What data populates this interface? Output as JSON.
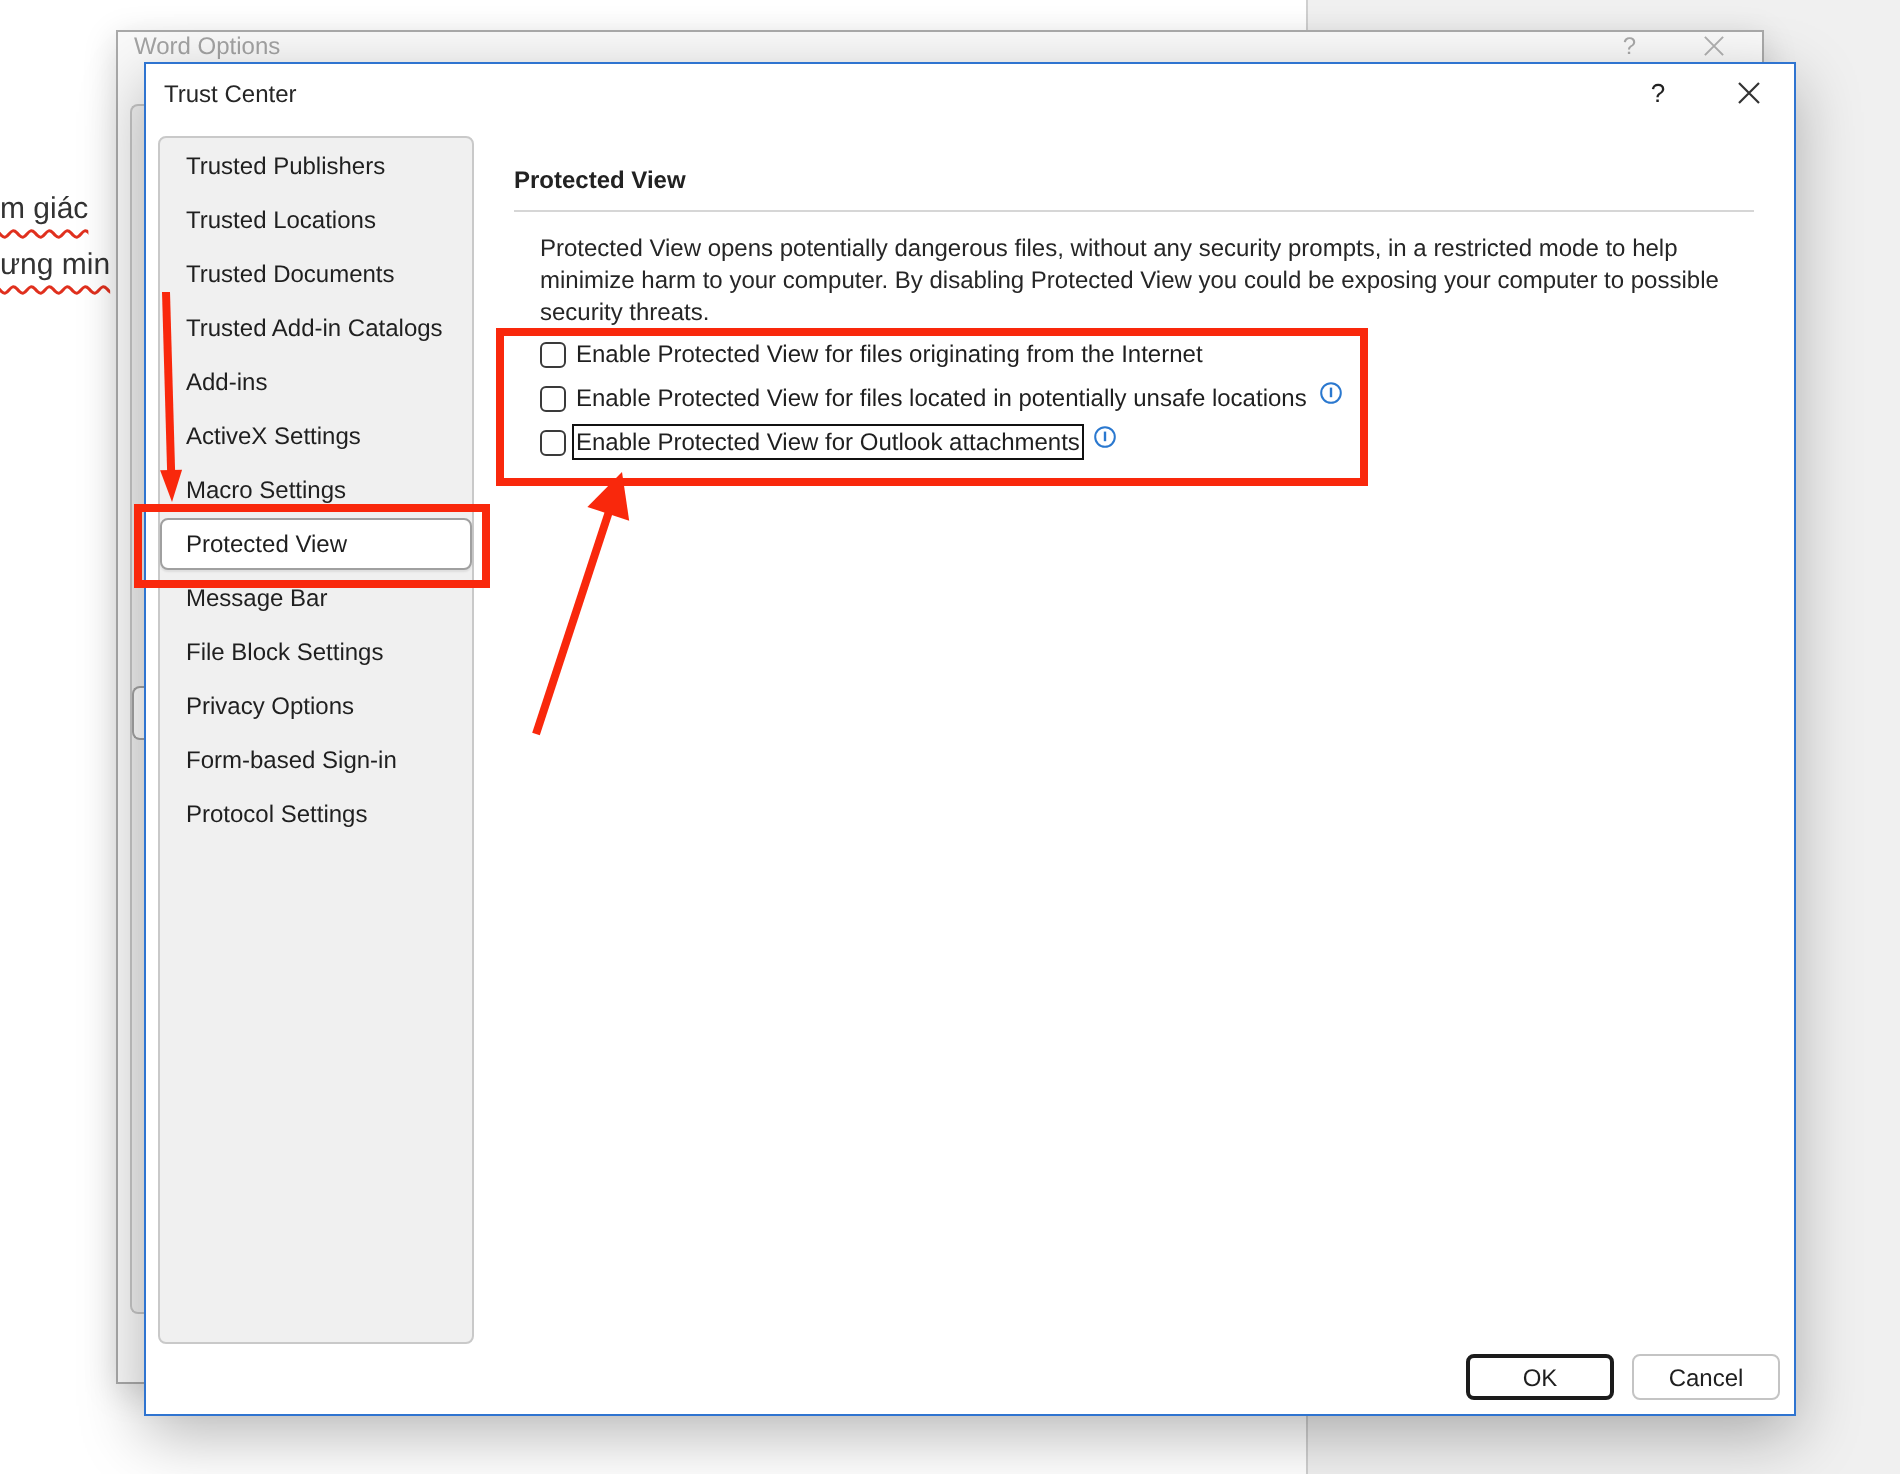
{
  "document": {
    "lines": [
      {
        "text": "m giác",
        "spelling_error": true
      },
      {
        "text": "ưng min",
        "spelling_error": true
      }
    ]
  },
  "background_window": {
    "title": "Word Options",
    "help_button": "?"
  },
  "window": {
    "title": "Trust Center",
    "help_button": "?"
  },
  "sidebar": {
    "items": [
      {
        "label": "Trusted Publishers",
        "selected": false,
        "annotated": false
      },
      {
        "label": "Trusted Locations",
        "selected": false,
        "annotated": false
      },
      {
        "label": "Trusted Documents",
        "selected": false,
        "annotated": false
      },
      {
        "label": "Trusted Add-in Catalogs",
        "selected": false,
        "annotated": false
      },
      {
        "label": "Add-ins",
        "selected": false,
        "annotated": false
      },
      {
        "label": "ActiveX Settings",
        "selected": false,
        "annotated": false
      },
      {
        "label": "Macro Settings",
        "selected": false,
        "annotated": false
      },
      {
        "label": "Protected View",
        "selected": true,
        "annotated": true
      },
      {
        "label": "Message Bar",
        "selected": false,
        "annotated": false
      },
      {
        "label": "File Block Settings",
        "selected": false,
        "annotated": false
      },
      {
        "label": "Privacy Options",
        "selected": false,
        "annotated": false
      },
      {
        "label": "Form-based Sign-in",
        "selected": false,
        "annotated": false
      },
      {
        "label": "Protocol Settings",
        "selected": false,
        "annotated": false
      }
    ]
  },
  "content": {
    "heading": "Protected View",
    "description": "Protected View opens potentially dangerous files, without any security prompts, in a restricted mode to help minimize harm to your computer. By disabling Protected View you could be exposing your computer to possible security threats.",
    "options_annotated": true,
    "options": [
      {
        "label": "Enable Protected View for files originating from the Internet",
        "checked": false,
        "focused": false,
        "info": false
      },
      {
        "label": "Enable Protected View for files located in potentially unsafe locations",
        "checked": false,
        "focused": false,
        "info": true
      },
      {
        "label": "Enable Protected View for Outlook attachments",
        "checked": false,
        "focused": true,
        "info": true
      }
    ]
  },
  "buttons": [
    {
      "label": "OK",
      "default": true
    },
    {
      "label": "Cancel",
      "default": false
    }
  ]
}
